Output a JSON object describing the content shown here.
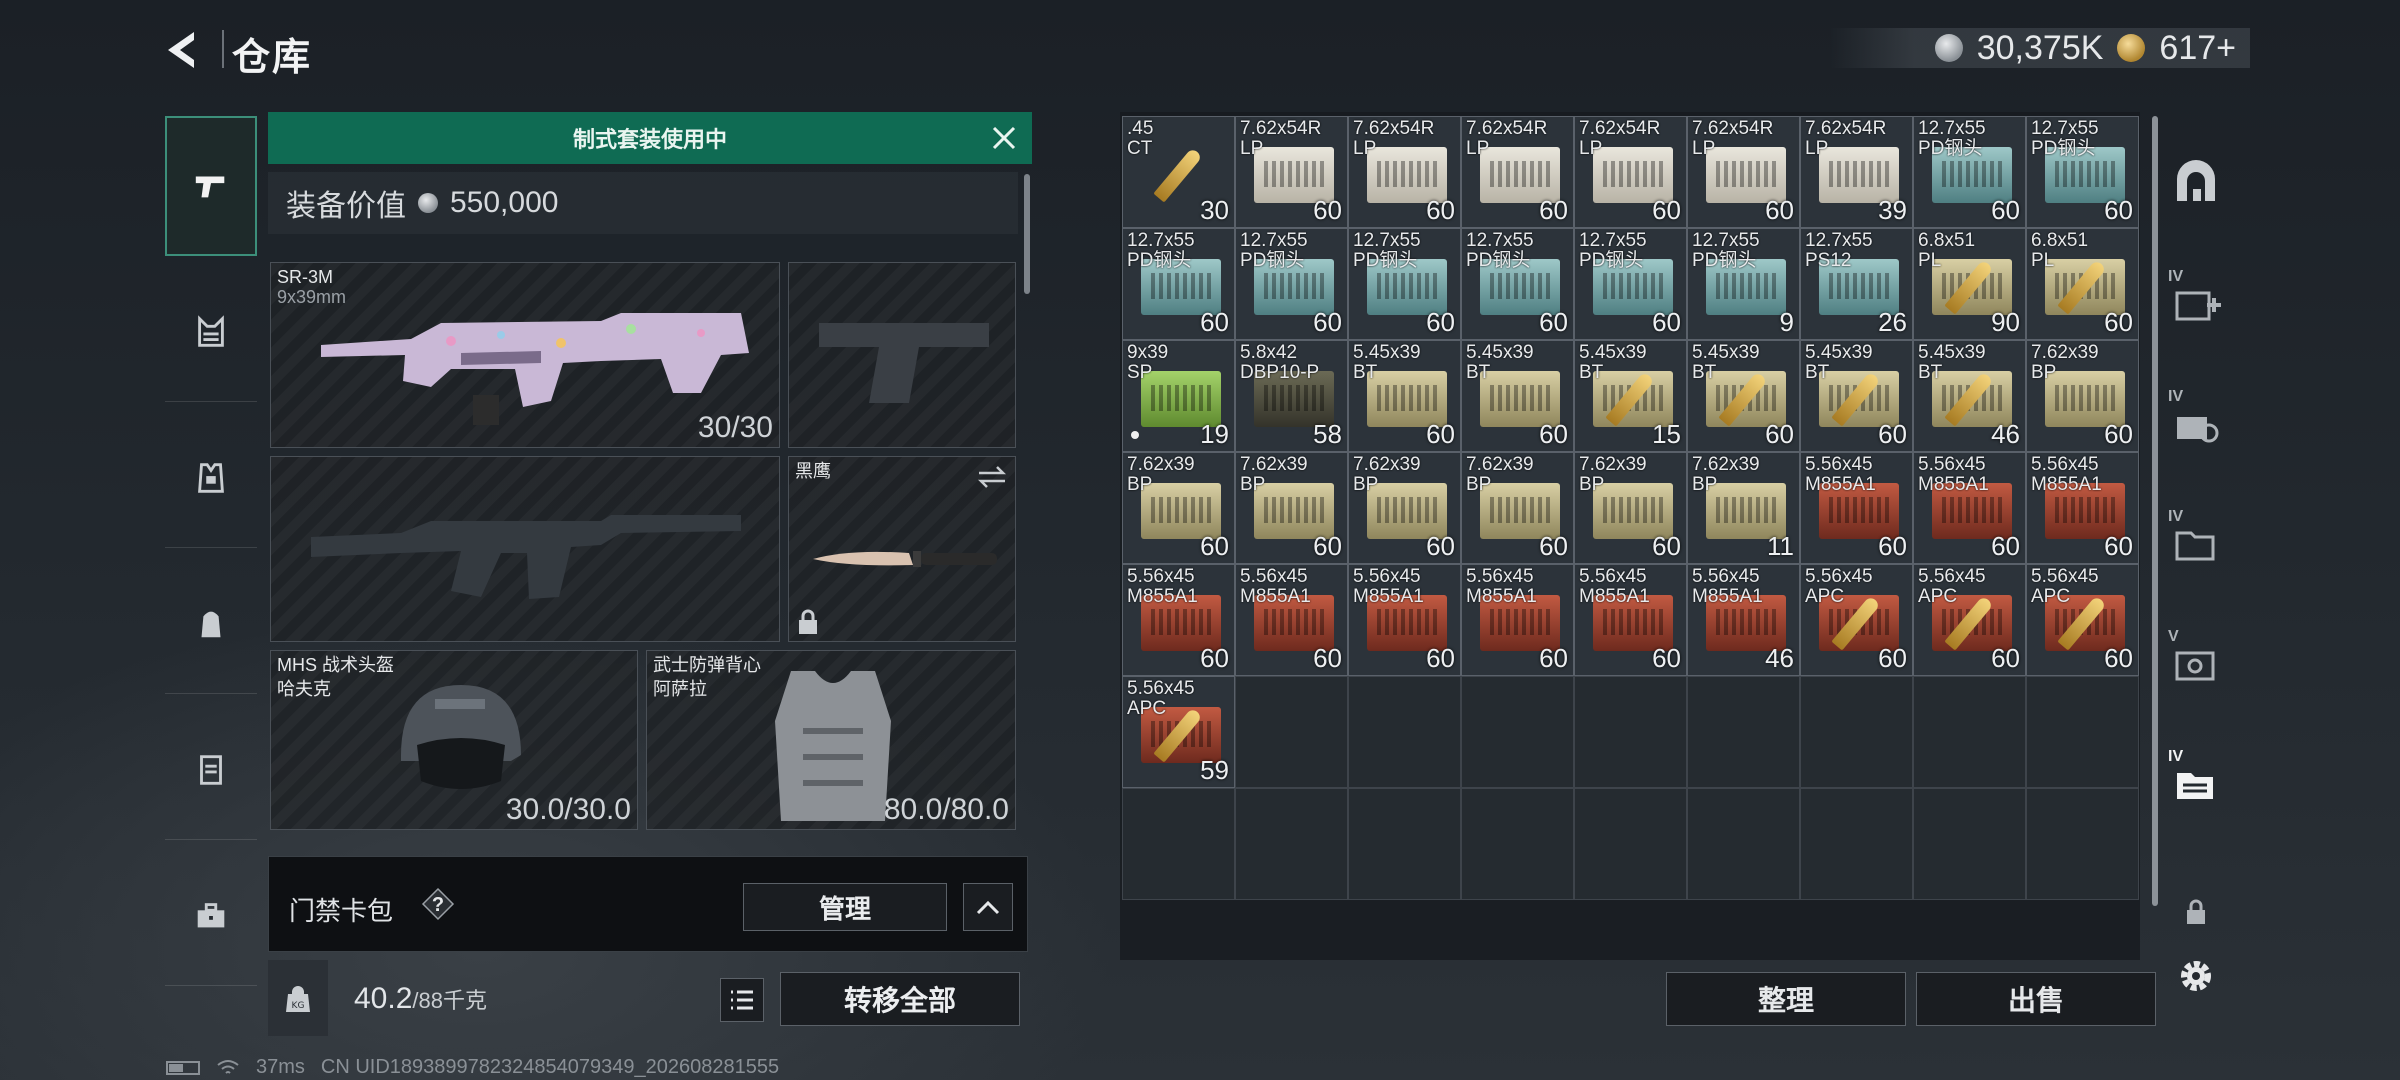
{
  "header": {
    "title": "仓库",
    "silver_amount": "30,375K",
    "gold_amount": "617+"
  },
  "loadout": {
    "banner": "制式套装使用中",
    "value_label": "装备价值",
    "value_amount": "550,000",
    "primary": {
      "name": "SR-3M",
      "caliber": "9x39mm",
      "ammo": "30/30"
    },
    "knife": {
      "name": "黑鹰"
    },
    "helmet": {
      "name": "MHS 战术头盔",
      "maker": "哈夫克",
      "durability": "30.0/30.0"
    },
    "armor": {
      "name": "武士防弹背心",
      "maker": "阿萨拉",
      "durability": "80.0/80.0"
    }
  },
  "keycard": {
    "label": "门禁卡包",
    "help": "?",
    "manage": "管理"
  },
  "weight": {
    "current": "40.2",
    "max": "/88千克",
    "transfer": "转移全部"
  },
  "storage": {
    "items": [
      {
        "name": ".45\nCT",
        "qty": "30",
        "color": "round"
      },
      {
        "name": "7.62x54R\nLP",
        "qty": "60",
        "color": "c-white"
      },
      {
        "name": "7.62x54R\nLP",
        "qty": "60",
        "color": "c-white"
      },
      {
        "name": "7.62x54R\nLP",
        "qty": "60",
        "color": "c-white"
      },
      {
        "name": "7.62x54R\nLP",
        "qty": "60",
        "color": "c-white"
      },
      {
        "name": "7.62x54R\nLP",
        "qty": "60",
        "color": "c-white"
      },
      {
        "name": "7.62x54R\nLP",
        "qty": "39",
        "color": "c-white"
      },
      {
        "name": "12.7x55\nPD钢头",
        "qty": "60",
        "color": "c-teal"
      },
      {
        "name": "12.7x55\nPD钢头",
        "qty": "60",
        "color": "c-teal"
      },
      {
        "name": "12.7x55\nPD钢头",
        "qty": "60",
        "color": "c-teal"
      },
      {
        "name": "12.7x55\nPD钢头",
        "qty": "60",
        "color": "c-teal"
      },
      {
        "name": "12.7x55\nPD钢头",
        "qty": "60",
        "color": "c-teal"
      },
      {
        "name": "12.7x55\nPD钢头",
        "qty": "60",
        "color": "c-teal"
      },
      {
        "name": "12.7x55\nPD钢头",
        "qty": "60",
        "color": "c-teal"
      },
      {
        "name": "12.7x55\nPD钢头",
        "qty": "9",
        "color": "c-teal"
      },
      {
        "name": "12.7x55\nPS12",
        "qty": "26",
        "color": "c-teal"
      },
      {
        "name": "6.8x51\nPL",
        "qty": "90",
        "color": "c-khaki"
      },
      {
        "name": "6.8x51\nPL",
        "qty": "60",
        "color": "c-khaki"
      },
      {
        "name": "9x39\nSP",
        "qty": "19",
        "color": "c-green",
        "dot": true
      },
      {
        "name": "5.8x42\nDBP10-P",
        "qty": "58",
        "color": "c-dark"
      },
      {
        "name": "5.45x39\nBT",
        "qty": "60",
        "color": "c-khaki"
      },
      {
        "name": "5.45x39\nBT",
        "qty": "60",
        "color": "c-khaki"
      },
      {
        "name": "5.45x39\nBT",
        "qty": "15",
        "color": "c-khaki"
      },
      {
        "name": "5.45x39\nBT",
        "qty": "60",
        "color": "c-khaki"
      },
      {
        "name": "5.45x39\nBT",
        "qty": "60",
        "color": "c-khaki"
      },
      {
        "name": "5.45x39\nBT",
        "qty": "46",
        "color": "c-khaki"
      },
      {
        "name": "7.62x39\nBP",
        "qty": "60",
        "color": "c-khaki"
      },
      {
        "name": "7.62x39\nBP",
        "qty": "60",
        "color": "c-khaki"
      },
      {
        "name": "7.62x39\nBP",
        "qty": "60",
        "color": "c-khaki"
      },
      {
        "name": "7.62x39\nBP",
        "qty": "60",
        "color": "c-khaki"
      },
      {
        "name": "7.62x39\nBP",
        "qty": "60",
        "color": "c-khaki"
      },
      {
        "name": "7.62x39\nBP",
        "qty": "60",
        "color": "c-khaki"
      },
      {
        "name": "7.62x39\nBP",
        "qty": "11",
        "color": "c-khaki"
      },
      {
        "name": "5.56x45\nM855A1",
        "qty": "60",
        "color": "c-red"
      },
      {
        "name": "5.56x45\nM855A1",
        "qty": "60",
        "color": "c-red"
      },
      {
        "name": "5.56x45\nM855A1",
        "qty": "60",
        "color": "c-red"
      },
      {
        "name": "5.56x45\nM855A1",
        "qty": "60",
        "color": "c-red"
      },
      {
        "name": "5.56x45\nM855A1",
        "qty": "60",
        "color": "c-red"
      },
      {
        "name": "5.56x45\nM855A1",
        "qty": "60",
        "color": "c-red"
      },
      {
        "name": "5.56x45\nM855A1",
        "qty": "60",
        "color": "c-red"
      },
      {
        "name": "5.56x45\nM855A1",
        "qty": "60",
        "color": "c-red"
      },
      {
        "name": "5.56x45\nM855A1",
        "qty": "46",
        "color": "c-red"
      },
      {
        "name": "5.56x45\nAPC",
        "qty": "60",
        "color": "c-red"
      },
      {
        "name": "5.56x45\nAPC",
        "qty": "60",
        "color": "c-red"
      },
      {
        "name": "5.56x45\nAPC",
        "qty": "60",
        "color": "c-red"
      },
      {
        "name": "5.56x45\nAPC",
        "qty": "59",
        "color": "c-red"
      }
    ],
    "total_cells": 63,
    "sort": "整理",
    "sell": "出售"
  },
  "right_rail": {
    "tiers": [
      "",
      "IV",
      "IV",
      "IV",
      "V",
      "IV",
      ""
    ]
  },
  "status": {
    "ping": "37ms",
    "uid": "CN UID1893899782324854079349_202608281555"
  }
}
